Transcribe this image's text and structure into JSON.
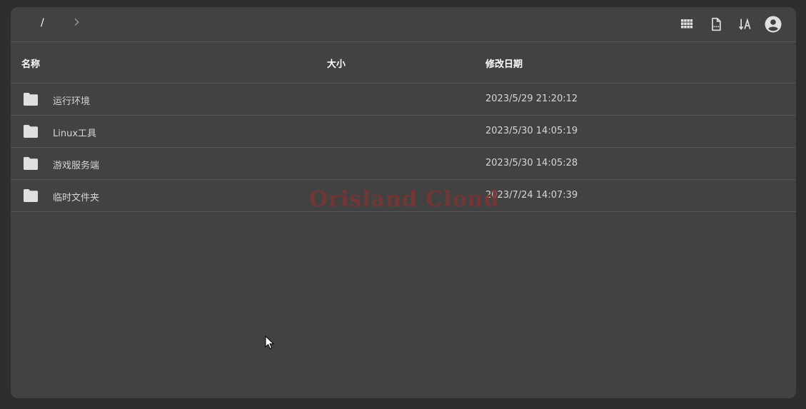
{
  "breadcrumb": {
    "root": "/"
  },
  "toolbar": {
    "buttons": [
      {
        "icon": "grid-view-icon"
      },
      {
        "icon": "new-file-icon"
      },
      {
        "icon": "sort-icon"
      },
      {
        "icon": "account-icon"
      }
    ]
  },
  "table": {
    "columns": {
      "name": "名称",
      "size": "大小",
      "modified": "修改日期"
    },
    "rows": [
      {
        "name": "运行环境",
        "size": "",
        "modified": "2023/5/29 21:20:12",
        "icon": "folder-icon"
      },
      {
        "name": "Linux工具",
        "size": "",
        "modified": "2023/5/30 14:05:19",
        "icon": "folder-icon"
      },
      {
        "name": "游戏服务端",
        "size": "",
        "modified": "2023/5/30 14:05:28",
        "icon": "folder-icon"
      },
      {
        "name": "临时文件夹",
        "size": "",
        "modified": "2023/7/24 14:07:39",
        "icon": "folder-icon"
      }
    ]
  },
  "watermark": "Orisland Cloud",
  "colors": {
    "page_bg": "#2e2e2e",
    "panel_bg": "#424242",
    "divider": "#575757",
    "icon": "#e0e0e0",
    "watermark": "#7a3535"
  }
}
